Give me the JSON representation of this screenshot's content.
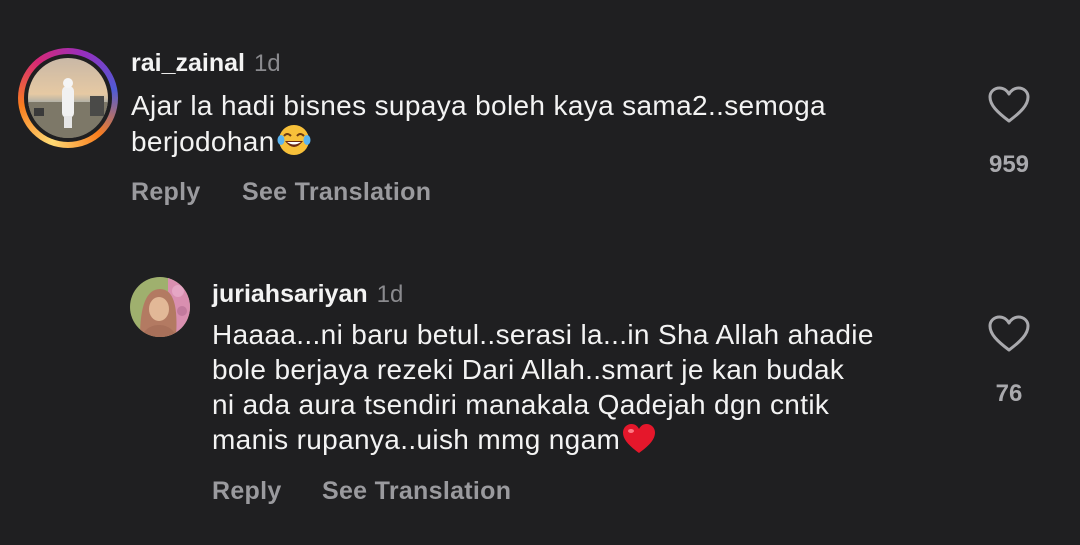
{
  "comments": [
    {
      "username": "rai_zainal",
      "time": "1d",
      "text_lines": [
        "Ajar la hadi bisnes supaya boleh kaya sama2..semoga",
        "berjodohan"
      ],
      "emoji": "laughing-tears-emoji",
      "reply_label": "Reply",
      "translate_label": "See Translation",
      "like_count": "959"
    },
    {
      "username": "juriahsariyan",
      "time": "1d",
      "text_lines": [
        "Haaaa...ni baru betul..serasi la...in Sha Allah ahadie",
        "bole berjaya rezeki Dari Allah..smart je kan budak",
        "ni ada aura tsendiri manakala Qadejah dgn cntik",
        "manis rupanya..uish mmg ngam"
      ],
      "emoji": "red-heart-emoji",
      "reply_label": "Reply",
      "translate_label": "See Translation",
      "like_count": "76"
    }
  ],
  "colors": {
    "background": "#1f1f21",
    "primary_text": "#f3f3f3",
    "secondary_text": "#9a9a9e",
    "story_ring": [
      "#feda75",
      "#fa7e1e",
      "#d62976",
      "#962fbf",
      "#4f5bd5"
    ]
  }
}
